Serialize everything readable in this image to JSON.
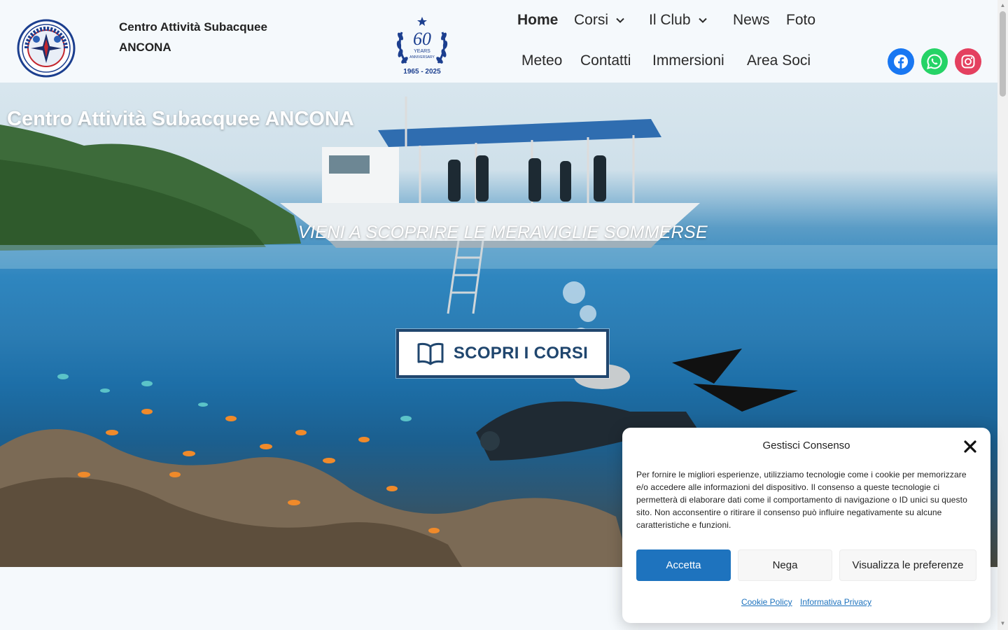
{
  "header": {
    "site_title_line1": "Centro Attività Subacquee",
    "site_title_line2": "ANCONA",
    "logo_text": "CENTRO ATTIVITÀ SUBACQUEE",
    "logo_bottom": "ANCONA",
    "anniversary_number": "60",
    "anniversary_years": "YEARS",
    "anniversary_word": "ANNIVERSARY",
    "anniversary_dates": "1965 - 2025"
  },
  "nav": {
    "items": [
      {
        "label": "Home",
        "active": true
      },
      {
        "label": "Corsi",
        "dropdown": true
      },
      {
        "label": "Il Club",
        "dropdown": true
      },
      {
        "label": "News"
      },
      {
        "label": "Foto"
      },
      {
        "label": "Meteo"
      },
      {
        "label": "Contatti"
      },
      {
        "label": "Immersioni"
      },
      {
        "label": "Area Soci"
      }
    ]
  },
  "social": [
    {
      "icon": "facebook-icon",
      "color": "#1877f2"
    },
    {
      "icon": "whatsapp-icon",
      "color": "#25d366"
    },
    {
      "icon": "instagram-icon",
      "color": "#e4405f"
    }
  ],
  "hero": {
    "title": "Centro Attività Subacquee ANCONA",
    "subtitle": "VIENI A SCOPRIRE LE MERAVIGLIE SOMMERSE",
    "cta_label": "SCOPRI I CORSI",
    "cta_icon": "book-open-icon"
  },
  "consent": {
    "title": "Gestisci Consenso",
    "text": "Per fornire le migliori esperienze, utilizziamo tecnologie come i cookie per memorizzare e/o accedere alle informazioni del dispositivo. Il consenso a queste tecnologie ci permetterà di elaborare dati come il comportamento di navigazione o ID unici su questo sito. Non acconsentire o ritirare il consenso può influire negativamente su alcune caratteristiche e funzioni.",
    "accept_label": "Accetta",
    "deny_label": "Nega",
    "prefs_label": "Visualizza le preferenze",
    "cookie_policy_label": "Cookie Policy",
    "privacy_label": "Informativa Privacy"
  },
  "colors": {
    "brand_navy": "#20466e",
    "accept_blue": "#1e73be"
  }
}
